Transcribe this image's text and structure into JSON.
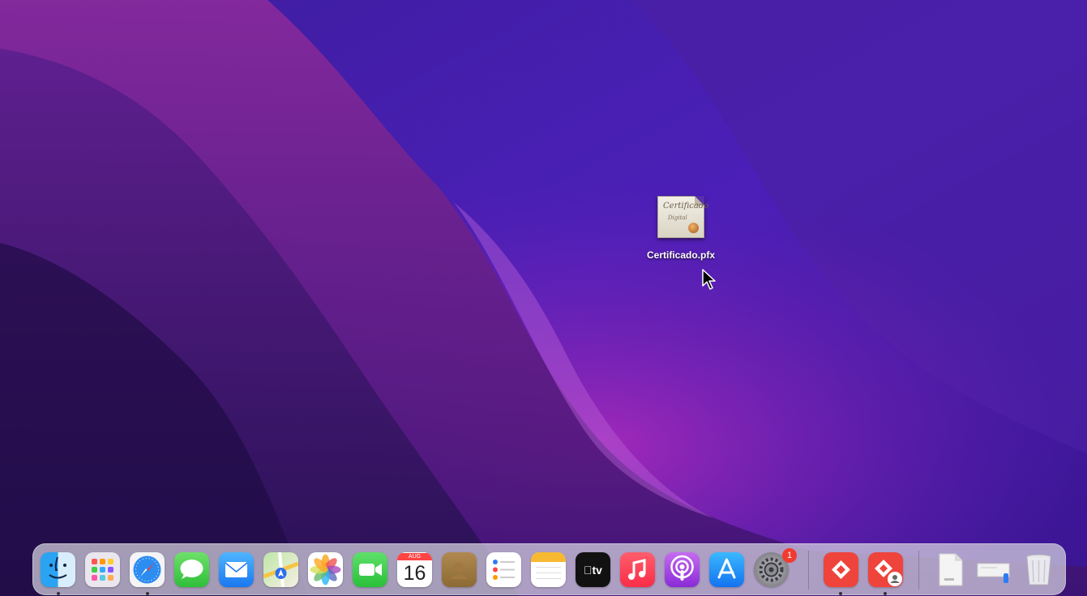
{
  "desktop": {
    "file": {
      "name": "Certificado.pfx",
      "thumb_text": "Certificado",
      "thumb_sub": "Digital"
    }
  },
  "dock": {
    "calendar": {
      "month": "AUG",
      "day": "16"
    },
    "apple_tv": {
      "label": "tv"
    },
    "system_settings_badge": "1",
    "apps": [
      {
        "name": "Finder",
        "icon": "finder-icon",
        "running": true
      },
      {
        "name": "Launchpad",
        "icon": "launchpad-icon",
        "running": false
      },
      {
        "name": "Safari",
        "icon": "safari-icon",
        "running": true
      },
      {
        "name": "Messages",
        "icon": "messages-icon",
        "running": false
      },
      {
        "name": "Mail",
        "icon": "mail-icon",
        "running": false
      },
      {
        "name": "Maps",
        "icon": "maps-icon",
        "running": false
      },
      {
        "name": "Photos",
        "icon": "photos-icon",
        "running": false
      },
      {
        "name": "FaceTime",
        "icon": "facetime-icon",
        "running": false
      },
      {
        "name": "Calendar",
        "icon": "calendar-icon",
        "running": false
      },
      {
        "name": "Contacts",
        "icon": "contacts-icon",
        "running": false
      },
      {
        "name": "Reminders",
        "icon": "reminders-icon",
        "running": false
      },
      {
        "name": "Notes",
        "icon": "notes-icon",
        "running": false
      },
      {
        "name": "TV",
        "icon": "apple-tv-icon",
        "running": false
      },
      {
        "name": "Music",
        "icon": "music-icon",
        "running": false
      },
      {
        "name": "Podcasts",
        "icon": "podcasts-icon",
        "running": false
      },
      {
        "name": "App Store",
        "icon": "app-store-icon",
        "running": false
      },
      {
        "name": "System Settings",
        "icon": "gear-icon",
        "running": false
      },
      {
        "name": "AnyDesk",
        "icon": "anydesk-icon",
        "running": true
      },
      {
        "name": "AnyDesk Admin",
        "icon": "anydesk-admin-icon",
        "running": true
      },
      {
        "name": "Document",
        "icon": "document-icon",
        "running": false
      },
      {
        "name": "Downloads Stack",
        "icon": "stack-icon",
        "running": false
      },
      {
        "name": "Trash",
        "icon": "trash-icon",
        "running": false
      }
    ],
    "colors": {
      "badge": "#f23b30",
      "anydesk": "#ef443b"
    }
  }
}
